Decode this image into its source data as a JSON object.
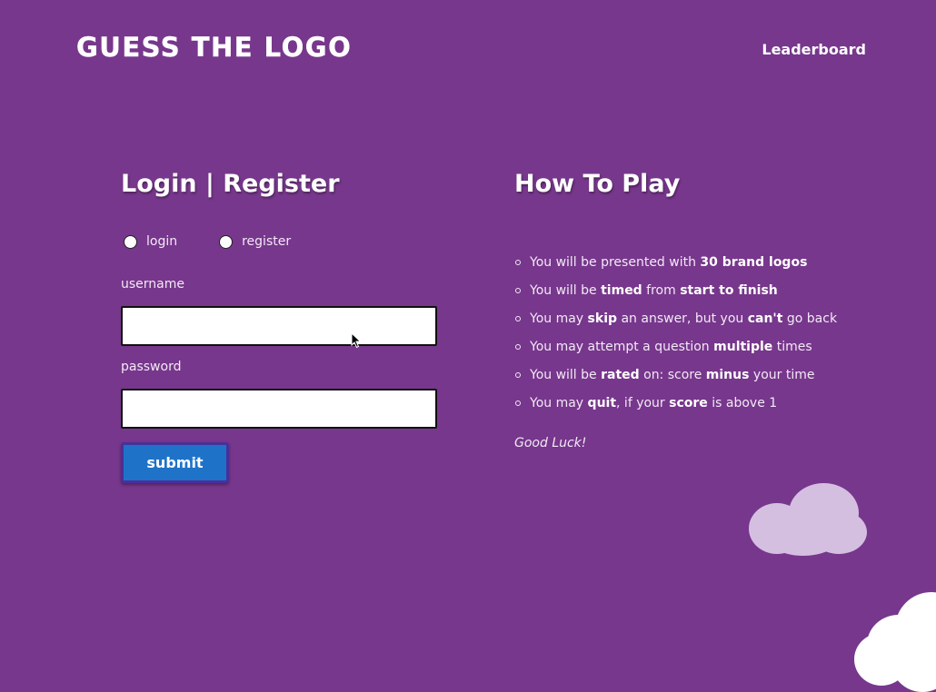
{
  "header": {
    "logo_text": "GUESS THE LOGO",
    "nav_leaderboard": "Leaderboard"
  },
  "login": {
    "title": "Login | Register",
    "radio_login": "login",
    "radio_register": "register",
    "username_label": "username",
    "password_label": "password",
    "username_value": "",
    "password_value": "",
    "submit_label": "submit"
  },
  "howto": {
    "title": "How To Play",
    "rules": [
      {
        "a": "You will be presented with ",
        "b": "30 brand logos",
        "c": "",
        "d": "",
        "e": ""
      },
      {
        "a": "You will be ",
        "b": "timed",
        "c": " from ",
        "d": "start to finish",
        "e": ""
      },
      {
        "a": "You may ",
        "b": "skip",
        "c": " an answer, but you ",
        "d": "can't",
        "e": " go back"
      },
      {
        "a": "You may attempt a question ",
        "b": "multiple",
        "c": " times",
        "d": "",
        "e": ""
      },
      {
        "a": "You will be ",
        "b": "rated",
        "c": " on: score ",
        "d": "minus",
        "e": " your time"
      },
      {
        "a": "You may ",
        "b": "quit",
        "c": ", if your ",
        "d": "score",
        "e": " is above 1"
      }
    ],
    "closing": "Good Luck!"
  },
  "colors": {
    "background": "#77378c",
    "button": "#1e73c8",
    "cloud_light": "#d5bfe1",
    "cloud_white": "#ffffff"
  }
}
